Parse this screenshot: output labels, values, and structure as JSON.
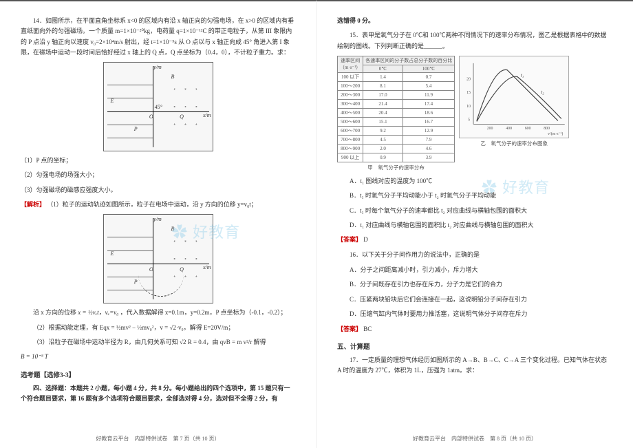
{
  "left": {
    "q14_intro": "14．如图所示，在平面直角坐标系 x<0 的区域内有沿 x 轴正向的匀强电场，在 x>0 的区域内有垂直纸面向外的匀强磁场。一个质量 m=1×10⁻²⁰kg，电荷量 q=1×10⁻¹²C 的带正电粒子，从第 III 象限内的 P 点沿 y 轴正向以速度 v₀=2×10⁴m/s 射出，经 t=1×10⁻⁵s 从 O 点以与 x 轴正向成 45° 角进入第 I 象限，在磁场中运动一段时间后恰好经过 x 轴上的 Q 点，Q 点坐标为（0.4，0），不计粒子重力。求：",
    "fig": {
      "ym": "y/m",
      "xm": "x/m",
      "E_label": "E",
      "B_label": "B",
      "P_label": "P",
      "O_label": "O",
      "Q_label": "Q",
      "angle": "45°"
    },
    "sub1": "（1）P 点的坐标；",
    "sub2": "（2）匀强电场的场强大小；",
    "sub3": "（3）匀强磁场的磁感应强度大小。",
    "sol_label": "【解析】",
    "sol1": "（1）粒子的运动轨迹如图所示，粒子在电场中运动，沿 y 方向的位移 y=v₀t；",
    "sol2_part1": "沿 x 方向的位移 ",
    "sol2_formula": "x = ½vₓt，vₓ=v₀",
    "sol2_part2": "，代入数据解得 x=0.1m，y=0.2m，P 点坐标为（-0.1，-0.2）；",
    "sol3": "（2）根据动能定理，有 Eqx = ½mv² − ½mv₀²，v = √2·v₀，解得 E=20V/m；",
    "sol4": "（3）沿粒子在磁场中运动半径为 R，由几何关系可知 √2 R = 0.4，由 qvB = m v²/r 解得",
    "sol5": "B = 10⁻³ T",
    "section_3_3": "选考题【选修3-3】",
    "section4_title": "四、选择题：本题共 2 小题，每小题 4 分，共 8 分。每小题给出的四个选项中，第 15 题只有一个符合题目要求，第 16 题有多个选项符合题目要求，全部选对得 4 分，选对但不全得 2 分，有",
    "footer": "好教育云平台　内部特供试卷　第 7 页（共 10 页）"
  },
  "right": {
    "cont_line": "选错得 0 分。",
    "q15_intro": "15．表甲是氧气分子在 0℃和 100℃两种不同情况下的速率分布情况，图乙是根据表格中的数据绘制的图线。下列判断正确的是______。",
    "table": {
      "head_col1": "速率区间",
      "head_col1_sub": "（m·s⁻¹）",
      "head_col2": "各速率区间的分子数占总分子数的百分比",
      "sub_0": "0℃",
      "sub_100": "100℃",
      "rows": [
        {
          "r": "100 以下",
          "a": "1.4",
          "b": "0.7"
        },
        {
          "r": "100～200",
          "a": "8.1",
          "b": "5.4"
        },
        {
          "r": "200～300",
          "a": "17.0",
          "b": "11.9"
        },
        {
          "r": "300～400",
          "a": "21.4",
          "b": "17.4"
        },
        {
          "r": "400～500",
          "a": "20.4",
          "b": "18.6"
        },
        {
          "r": "500～600",
          "a": "15.1",
          "b": "16.7"
        },
        {
          "r": "600～700",
          "a": "9.2",
          "b": "12.9"
        },
        {
          "r": "700～800",
          "a": "4.5",
          "b": "7.9"
        },
        {
          "r": "800～900",
          "a": "2.0",
          "b": "4.6"
        },
        {
          "r": "900 以上",
          "a": "0.9",
          "b": "3.9"
        }
      ]
    },
    "caption_left": "甲　氧气分子的速率分布",
    "caption_right": "乙　氧气分子的速率分布图象",
    "chart_axis_y": "各速率区间的分子数占总分子数的百分比",
    "chart_axis_x": "v/(m·s⁻¹)",
    "chart_t1": "t₁",
    "chart_t2": "t₂",
    "chart_ticks": [
      "5",
      "10",
      "15",
      "20"
    ],
    "chart_xticks": [
      "200",
      "400",
      "600",
      "800"
    ],
    "optA": "A．t₁ 图线对应的温度为 100℃",
    "optB": "B．t₁ 时氧气分子平均动能小于 t₂ 时氧气分子平均动能",
    "optC": "C．t₁ 时每个氧气分子的速率都比 t₂ 对应曲线与横轴包围的面积大",
    "optD": "D．t₁ 对应曲线与横轴包围的面积比 t₂ 对应曲线与横轴包围的面积大",
    "ans15_label": "【答案】",
    "ans15": "D",
    "q16_intro": "16．以下关于分子间作用力的说法中，正确的是",
    "q16A": "A．分子之间距离减小时，引力减小，斥力增大",
    "q16B": "B．分子间既存在引力也存在斥力，分子力是它们的合力",
    "q16C": "C．压紧两块铅块后它们会连接在一起，这说明铅分子间存在引力",
    "q16D": "D．压缩气缸内气体时要用力推活塞，这说明气体分子间存在斥力",
    "ans16_label": "【答案】",
    "ans16": "BC",
    "section5": "五、计算题",
    "q17": "17．一定质量的理想气体经历如图所示的 A→B、B→C、C→A 三个变化过程。已知气体在状态 A 时的温度为 27℃，体积为 1L，压强为 1atm。求：",
    "footer": "好教育云平台　内部特供试卷　第 8 页（共 10 页）"
  },
  "chart_data": {
    "type": "line",
    "title": "氧气分子的速率分布图象",
    "xlabel": "v/(m·s⁻¹)",
    "ylabel": "各速率区间的分子数占总分子数的百分比",
    "x": [
      50,
      150,
      250,
      350,
      450,
      550,
      650,
      750,
      850,
      950
    ],
    "series": [
      {
        "name": "t₁ (0℃)",
        "values": [
          1.4,
          8.1,
          17.0,
          21.4,
          20.4,
          15.1,
          9.2,
          4.5,
          2.0,
          0.9
        ]
      },
      {
        "name": "t₂ (100℃)",
        "values": [
          0.7,
          5.4,
          11.9,
          17.4,
          18.6,
          16.7,
          12.9,
          7.9,
          4.6,
          3.9
        ]
      }
    ],
    "ylim": [
      0,
      22
    ],
    "xlim": [
      0,
      1000
    ]
  }
}
